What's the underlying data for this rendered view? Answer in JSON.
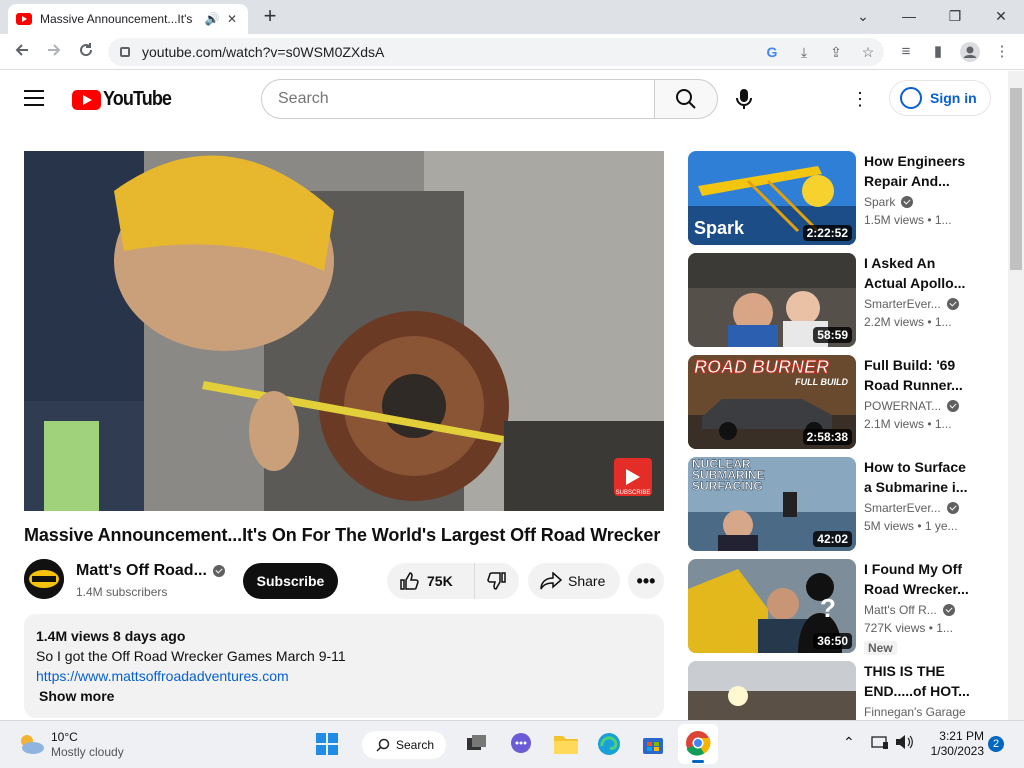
{
  "browser": {
    "tab_title": "Massive Announcement...It's",
    "new_tab": "+",
    "url": "youtube.com/watch?v=s0WSM0ZXdsA",
    "window": {
      "minimize": "—",
      "restore": "❐",
      "close": "✕",
      "tab_list": "⌄"
    }
  },
  "masthead": {
    "logo_text": "YouTube",
    "search_placeholder": "Search",
    "sign_in": "Sign in"
  },
  "video": {
    "title": "Massive Announcement...It's On For The World's Largest Off Road Wrecker",
    "channel": "Matt's Off Road...",
    "subscribers": "1.4M subscribers",
    "subscribe_label": "Subscribe",
    "likes": "75K",
    "share_label": "Share",
    "logo_text": "SUBSCRIBE"
  },
  "description": {
    "meta": "1.4M views  8 days ago",
    "line1": "So I got the Off Road Wrecker Games March 9-11",
    "link": "https://www.mattsoffroadadventures.com",
    "show_more": "Show more"
  },
  "recommendations": [
    {
      "title": "How Engineers Repair And...",
      "channel": "Spark",
      "meta": "1.5M views  • 1...",
      "duration": "2:22:52",
      "overlay": "Spark"
    },
    {
      "title": "I Asked An Actual Apollo...",
      "channel": "SmarterEver...",
      "meta": "2.2M views  • 1...",
      "duration": "58:59",
      "overlay": ""
    },
    {
      "title": "Full Build: '69 Road Runner...",
      "channel": "POWERNAT...",
      "meta": "2.1M views  • 1...",
      "duration": "2:58:38",
      "overlay": "ROAD BURNER",
      "overlay2": "FULL BUILD"
    },
    {
      "title": "How to Surface a Submarine i...",
      "channel": "SmarterEver...",
      "meta": "5M views  • 1 ye...",
      "duration": "42:02",
      "overlay": "NUCLEAR SUBMARINE SURFACING"
    },
    {
      "title": "I Found My Off Road Wrecker...",
      "channel": "Matt's Off R...",
      "meta": "727K views  • 1...",
      "duration": "36:50",
      "badge": "New",
      "overlay": "?"
    },
    {
      "title": "THIS IS THE END.....of HOT...",
      "channel": "Finnegan's Garage",
      "meta": "",
      "duration": ""
    }
  ],
  "taskbar": {
    "temp": "10°C",
    "weather": "Mostly cloudy",
    "search": "Search",
    "time": "3:21 PM",
    "date": "1/30/2023",
    "notif_count": "2"
  },
  "colors": {
    "yt_red": "#ff0000",
    "link_blue": "#065fd4",
    "chrome_frame": "#dee1e6"
  }
}
